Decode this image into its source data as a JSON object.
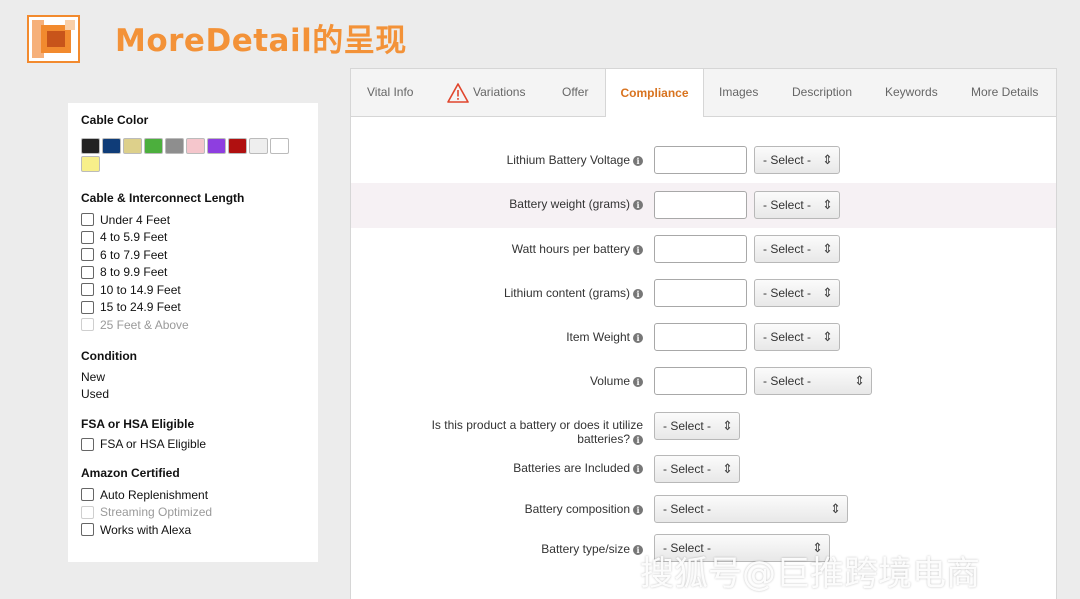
{
  "slide": {
    "title": "MoreDetail的呈现",
    "watermark": "搜狐号@巨推跨境电商"
  },
  "filters": {
    "cable_color": {
      "heading": "Cable Color",
      "swatches": [
        "#222222",
        "#0f3c78",
        "#ddd08b",
        "#4caf3d",
        "#8e8e8e",
        "#f5c6cc",
        "#8e3ee0",
        "#b01010",
        "#eeeeee",
        "#ffffff",
        "#f7ef8a"
      ]
    },
    "cable_length": {
      "heading": "Cable & Interconnect Length",
      "options": [
        "Under 4 Feet",
        "4 to 5.9 Feet",
        "6 to 7.9 Feet",
        "8 to 9.9 Feet",
        "10 to 14.9 Feet",
        "15 to 24.9 Feet",
        "25 Feet & Above"
      ]
    },
    "condition": {
      "heading": "Condition",
      "options": [
        "New",
        "Used"
      ]
    },
    "fsa": {
      "heading": "FSA or HSA Eligible",
      "option": "FSA or HSA Eligible"
    },
    "amazon_certified": {
      "heading": "Amazon Certified",
      "options": [
        "Auto Replenishment",
        "Streaming Optimized",
        "Works with Alexa"
      ]
    }
  },
  "tabs": [
    {
      "label": "Vital Info"
    },
    {
      "label": "Variations"
    },
    {
      "label": "Offer"
    },
    {
      "label": "Compliance"
    },
    {
      "label": "Images"
    },
    {
      "label": "Description"
    },
    {
      "label": "Keywords"
    },
    {
      "label": "More Details"
    }
  ],
  "form": {
    "select_placeholder": "- Select -",
    "info_glyph": "i",
    "fields": [
      {
        "label": "Lithium Battery Voltage"
      },
      {
        "label": "Battery weight (grams)"
      },
      {
        "label": "Watt hours per battery"
      },
      {
        "label": "Lithium content (grams)"
      },
      {
        "label": "Item Weight"
      },
      {
        "label": "Volume"
      },
      {
        "label_line1": "Is this product a battery or does it utilize",
        "label_line2": "batteries?"
      },
      {
        "label": "Batteries are Included"
      },
      {
        "label": "Battery composition"
      },
      {
        "label": "Battery type/size"
      }
    ]
  },
  "colors": {
    "accent_orange": "#f39238",
    "active_tab": "#d8731f",
    "warning_red": "#e0452c"
  }
}
